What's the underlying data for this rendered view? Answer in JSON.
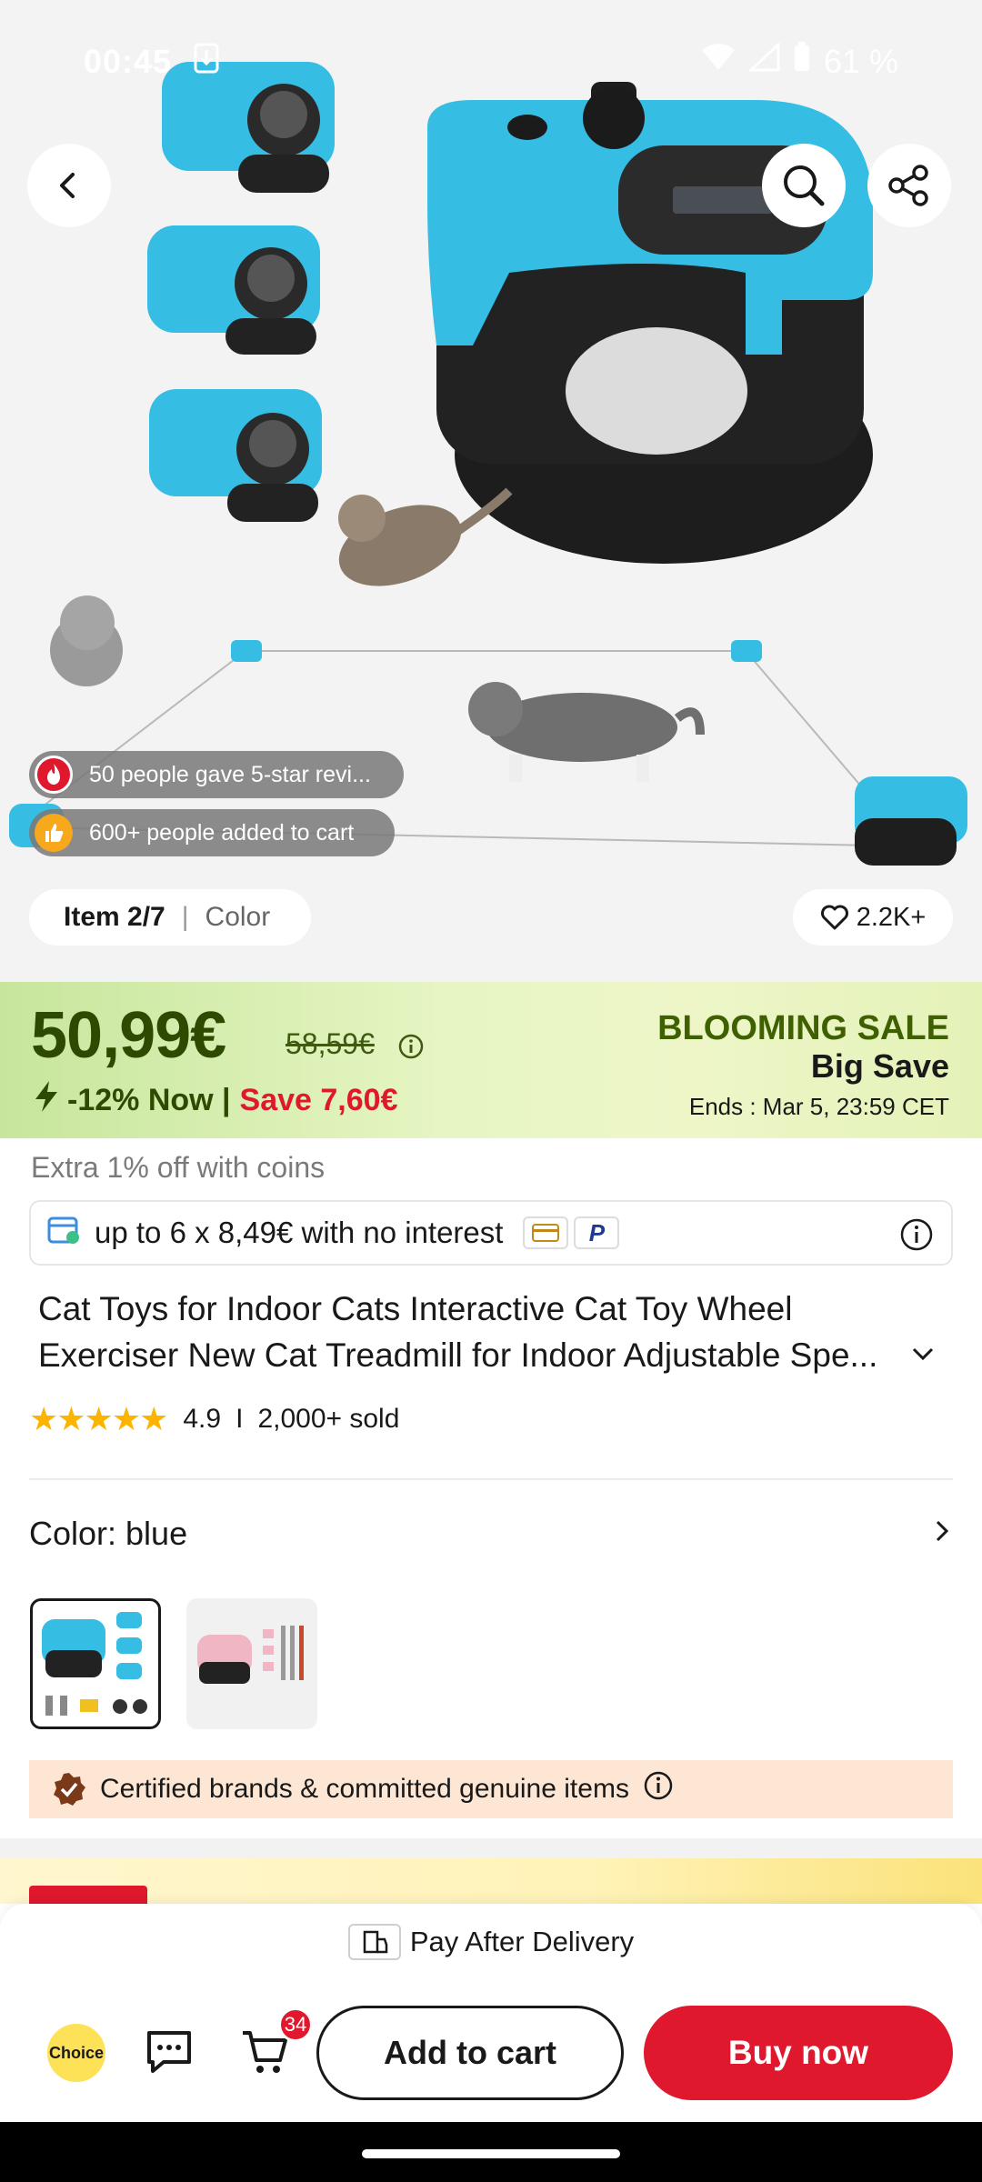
{
  "status_bar": {
    "time": "00:45",
    "battery": "61 %"
  },
  "hero": {
    "badges": {
      "reviews": "50 people gave 5-star revi...",
      "cart": "600+ people added to cart"
    },
    "item_current": "Item 2/7",
    "item_label": "Color",
    "wishlist_count": "2.2K+"
  },
  "price": {
    "current": "50,99€",
    "original": "58,59€",
    "discount": "-12% Now |",
    "save": "Save 7,60€",
    "sale_title": "BLOOMING SALE",
    "sale_subtitle": "Big Save",
    "ends": "Ends :  Mar 5, 23:59 CET"
  },
  "coins_text": "Extra 1% off with coins",
  "installment_text": "up to 6 x 8,49€ with no interest",
  "product": {
    "title": "Cat Toys for Indoor Cats Interactive Cat Toy Wheel Exerciser New Cat Treadmill for Indoor Adjustable Spe...",
    "rating": "4.9",
    "sold": "2,000+ sold"
  },
  "color": {
    "label": "Color: blue",
    "options": [
      "blue",
      "pink"
    ]
  },
  "certified_text": "Certified brands & committed genuine items",
  "bottom": {
    "pay_after": "Pay After Delivery",
    "choice_label": "Choice",
    "cart_count": "34",
    "add_to_cart": "Add to cart",
    "buy_now": "Buy now"
  },
  "colors": {
    "primary_red": "#e0182d",
    "price_green": "#2e4a00",
    "star_gold": "#fcb400",
    "product_blue": "#35bde4"
  }
}
